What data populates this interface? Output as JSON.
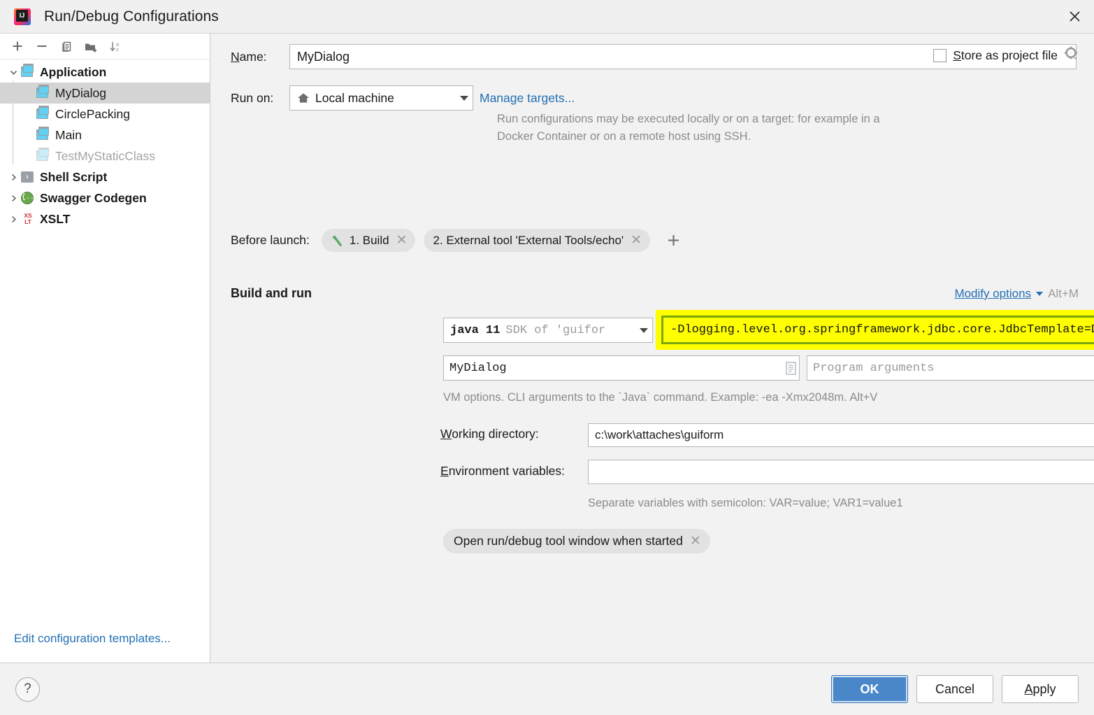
{
  "window": {
    "title": "Run/Debug Configurations",
    "app_icon": "intellij-idea-logo",
    "close_icon": "close-icon"
  },
  "sidebar": {
    "toolbar": [
      {
        "name": "add-configuration-button",
        "icon": "plus-icon"
      },
      {
        "name": "remove-configuration-button",
        "icon": "minus-icon"
      },
      {
        "name": "copy-configuration-button",
        "icon": "copy-icon"
      },
      {
        "name": "new-folder-button",
        "icon": "new-folder-icon"
      },
      {
        "name": "sort-configurations-button",
        "icon": "sort-alphabetically-icon"
      }
    ],
    "tree": [
      {
        "label": "Application",
        "icon": "application-icon",
        "level": 0,
        "bold": true,
        "expanded": true,
        "selected": false,
        "muted": false
      },
      {
        "label": "MyDialog",
        "icon": "application-icon",
        "level": 1,
        "bold": false,
        "expanded": null,
        "selected": true,
        "muted": false
      },
      {
        "label": "CirclePacking",
        "icon": "application-icon",
        "level": 1,
        "bold": false,
        "expanded": null,
        "selected": false,
        "muted": false
      },
      {
        "label": "Main",
        "icon": "application-icon",
        "level": 1,
        "bold": false,
        "expanded": null,
        "selected": false,
        "muted": false
      },
      {
        "label": "TestMyStaticClass",
        "icon": "application-icon",
        "level": 1,
        "bold": false,
        "expanded": null,
        "selected": false,
        "muted": true
      },
      {
        "label": "Shell Script",
        "icon": "shell-script-icon",
        "level": 0,
        "bold": true,
        "expanded": false,
        "selected": false,
        "muted": false
      },
      {
        "label": "Swagger Codegen",
        "icon": "swagger-codegen-icon",
        "level": 0,
        "bold": true,
        "expanded": false,
        "selected": false,
        "muted": false
      },
      {
        "label": "XSLT",
        "icon": "xslt-icon",
        "level": 0,
        "bold": true,
        "expanded": false,
        "selected": false,
        "muted": false
      }
    ],
    "edit_templates_link": "Edit configuration templates..."
  },
  "form": {
    "name_label": "Name:",
    "name_label_mnemonic": "N",
    "name_value": "MyDialog",
    "store_as_project_file_label": "Store as project file",
    "store_as_project_file_mnemonic": "S",
    "store_as_project_file_checked": false,
    "store_gear_icon": "gear-icon",
    "run_on_label": "Run on:",
    "run_on_value": "Local machine",
    "run_on_icon": "home-icon",
    "manage_targets_link": "Manage targets...",
    "run_on_hint": "Run configurations may be executed locally or on a target: for example in a Docker Container or on a remote host using SSH.",
    "before_launch_label": "Before launch:",
    "before_launch_items": [
      {
        "label": "1. Build",
        "icon": "build-hammer-icon",
        "removable": true
      },
      {
        "label": "2. External tool 'External Tools/echo'",
        "icon": null,
        "removable": true
      }
    ],
    "before_launch_add_icon": "plus-icon",
    "build_and_run_title": "Build and run",
    "modify_options_link": "Modify options",
    "modify_options_shortcut": "Alt+M",
    "jdk_name": "java 11",
    "jdk_description": "SDK of 'guifor",
    "vm_options_value": "-Dlogging.level.org.springframework.jdbc.core.JdbcTemplate=DEBUG",
    "vm_options_highlight_color": "#ffff00",
    "vm_options_border_color": "#7aa80c",
    "main_class_value": "MyDialog",
    "program_arguments_placeholder": "Program arguments",
    "vm_hint": "VM options. CLI arguments to the `Java` command. Example: -ea -Xmx2048m. Alt+V",
    "working_directory_label": "Working directory:",
    "working_directory_mnemonic": "W",
    "working_directory_value": "c:\\work\\attaches\\guiform",
    "environment_variables_label": "Environment variables:",
    "environment_variables_mnemonic": "E",
    "environment_variables_value": "",
    "environment_variables_hint": "Separate variables with semicolon: VAR=value; VAR1=value1",
    "tool_window_chip": "Open run/debug tool window when started",
    "macro_icon": "macro-list-icon",
    "expand_icon": "expand-icon",
    "browse_icon": "folder-browse-icon"
  },
  "footer": {
    "help_label": "?",
    "ok_label": "OK",
    "cancel_label": "Cancel",
    "apply_label": "Apply",
    "apply_mnemonic": "A",
    "ok_color": "#4a87c8"
  }
}
